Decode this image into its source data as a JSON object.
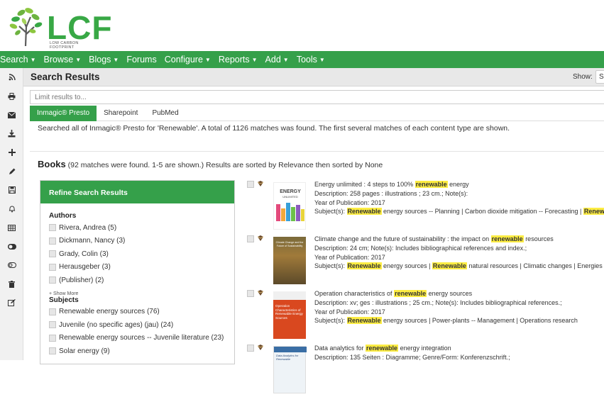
{
  "logo": {
    "text": "LCF",
    "subtitle": "LOW CARBON FOOTPRINT"
  },
  "nav": [
    {
      "label": "Search",
      "caret": true
    },
    {
      "label": "Browse",
      "caret": true
    },
    {
      "label": "Blogs",
      "caret": true
    },
    {
      "label": "Forums",
      "caret": false
    },
    {
      "label": "Configure",
      "caret": true
    },
    {
      "label": "Reports",
      "caret": true
    },
    {
      "label": "Add",
      "caret": true
    },
    {
      "label": "Tools",
      "caret": true
    }
  ],
  "page": {
    "title": "Search Results",
    "show_label": "Show:",
    "show_value": "Su"
  },
  "search": {
    "placeholder": "Limit results to..."
  },
  "tabs": [
    "Inmagic® Presto",
    "Sharepoint",
    "PubMed"
  ],
  "summary": "Searched all of Inmagic® Presto for 'Renewable'. A total of 1126 matches was found. The first several matches of each content type are shown.",
  "books": {
    "heading": "Books",
    "detail": "(92 matches were found. 1-5 are shown.) Results are sorted by Relevance then sorted by None"
  },
  "refine": {
    "title": "Refine Search Results",
    "authors_title": "Authors",
    "authors": [
      "Rivera, Andrea (5)",
      "Dickmann, Nancy (3)",
      "Grady, Colin (3)",
      "Herausgeber (3)",
      "(Publisher) (2)"
    ],
    "show_more": "+ Show More",
    "subjects_title": "Subjects",
    "subjects": [
      "Renewable energy sources (76)",
      "Juvenile (no specific ages) (jau) (24)",
      "Renewable energy sources -- Juvenile literature (23)",
      "Solar energy (9)"
    ]
  },
  "results": [
    {
      "title_pre": "Energy unlimited : 4 steps to 100% ",
      "title_hl": "renewable",
      "title_post": " energy",
      "desc": "Description: 258 pages : illustrations ; 23 cm.; Note(s):",
      "year": "Year of Publication: 2017",
      "subj_pre": "Subject(s): ",
      "subj_hl": "Renewable",
      "subj_post": " energy sources -- Planning | Carbon dioxide mitigation -- Forecasting | ",
      "subj_hl2": "Renewable",
      "cover_title": "ENERGY",
      "cover_sub": "UNLIMITED"
    },
    {
      "title_pre": "Climate change and the future of sustainability : the impact on ",
      "title_hl": "renewable",
      "title_post": " resources",
      "desc": "Description: 24 cm; Note(s): Includes bibliographical references and index.;",
      "year": "Year of Publication: 2017",
      "subj_pre": "Subject(s): ",
      "subj_hl": "Renewable",
      "subj_post": " energy sources | ",
      "subj_hl2": "Renewable",
      "subj_post2": " natural resources | Climatic changes | Energies ren",
      "cover_title": "Climate Change and the Future of Sustainability"
    },
    {
      "title_pre": "Operation characteristics of ",
      "title_hl": "renewable",
      "title_post": " energy sources",
      "desc": "Description: xv; ges : illustrations ; 25 cm.; Note(s): Includes bibliographical references.;",
      "year": "Year of Publication: 2017",
      "subj_pre": "Subject(s): ",
      "subj_hl": "Renewable",
      "subj_post": " energy sources | Power-plants -- Management | Operations research",
      "cover_title": "Operation Characteristics of Renewable Energy Sources"
    },
    {
      "title_pre": "Data analytics for ",
      "title_hl": "renewable",
      "title_post": " energy integration",
      "desc": "Description: 135 Seiten : Diagramme; Genre/Form: Konferenzschrift.;",
      "cover_title": "Data Analytics for Renewable"
    }
  ],
  "colors": {
    "brand_green": "#35a04a",
    "logo_green": "#38a845",
    "highlight": "#fcec43"
  }
}
